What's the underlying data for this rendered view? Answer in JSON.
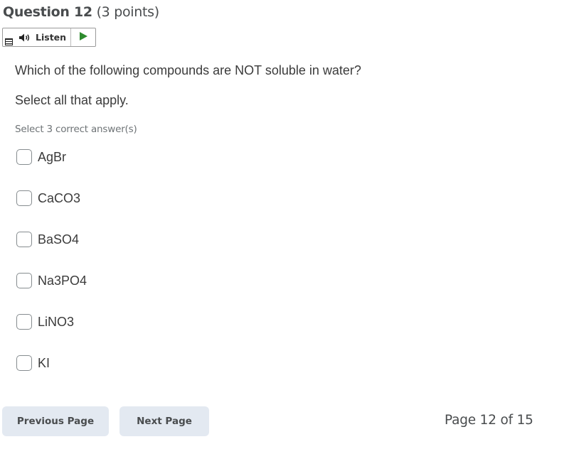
{
  "question": {
    "title": "Question 12",
    "points": "(3 points)",
    "text": "Which of the following compounds are NOT soluble in water?",
    "instruction": "Select all that apply.",
    "hint": "Select 3 correct answer(s)"
  },
  "listen": {
    "label": "Listen",
    "menu_icon": "menu-icon",
    "speaker_icon": "speaker-icon",
    "play_icon": "play-icon",
    "play_color": "#2e8b2e"
  },
  "options": [
    {
      "label": "AgBr",
      "checked": false
    },
    {
      "label": "CaCO3",
      "checked": false
    },
    {
      "label": "BaSO4",
      "checked": false
    },
    {
      "label": "Na3PO4",
      "checked": false
    },
    {
      "label": "LiNO3",
      "checked": false
    },
    {
      "label": "KI",
      "checked": false
    }
  ],
  "navigation": {
    "previous_label": "Previous Page",
    "next_label": "Next Page",
    "page_indicator": "Page 12 of 15"
  },
  "colors": {
    "button_bg": "#e3e9f1",
    "text": "#3b3b3b",
    "hint": "#6e7376"
  }
}
